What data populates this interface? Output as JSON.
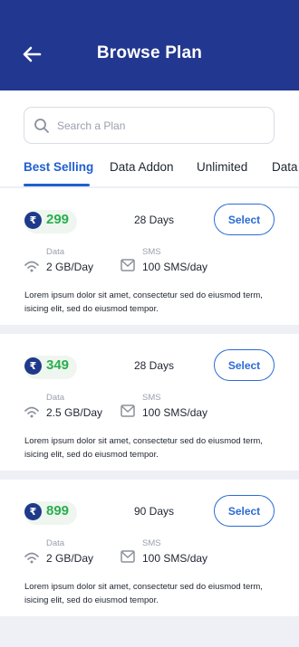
{
  "header": {
    "title": "Browse Plan"
  },
  "search": {
    "placeholder": "Search a Plan"
  },
  "tabs": [
    {
      "label": "Best Selling"
    },
    {
      "label": "Data Addon"
    },
    {
      "label": "Unlimited"
    },
    {
      "label": "Data"
    }
  ],
  "plans": [
    {
      "currency": "₹",
      "price": "299",
      "validity": "28 Days",
      "select_label": "Select",
      "data_label": "Data",
      "data_value": "2 GB/Day",
      "sms_label": "SMS",
      "sms_value": "100 SMS/day",
      "description": "Lorem ipsum dolor sit amet, consectetur  sed do eiusmod term, isicing elit, sed do eiusmod tempor."
    },
    {
      "currency": "₹",
      "price": "349",
      "validity": "28 Days",
      "select_label": "Select",
      "data_label": "Data",
      "data_value": "2.5 GB/Day",
      "sms_label": "SMS",
      "sms_value": "100 SMS/day",
      "description": "Lorem ipsum dolor sit amet, consectetur  sed do eiusmod term, isicing elit, sed do eiusmod tempor."
    },
    {
      "currency": "₹",
      "price": "899",
      "validity": "90 Days",
      "select_label": "Select",
      "data_label": "Data",
      "data_value": "2 GB/Day",
      "sms_label": "SMS",
      "sms_value": "100 SMS/day",
      "description": "Lorem ipsum dolor sit amet, consectetur  sed do eiusmod term, isicing elit, sed do eiusmod tempor."
    }
  ],
  "colors": {
    "header_bg": "#22378f",
    "accent": "#1f5fd1",
    "price_green": "#2aae4f"
  },
  "icons": [
    "back-arrow-icon",
    "search-icon",
    "rupee-icon",
    "wifi-icon",
    "message-icon"
  ]
}
